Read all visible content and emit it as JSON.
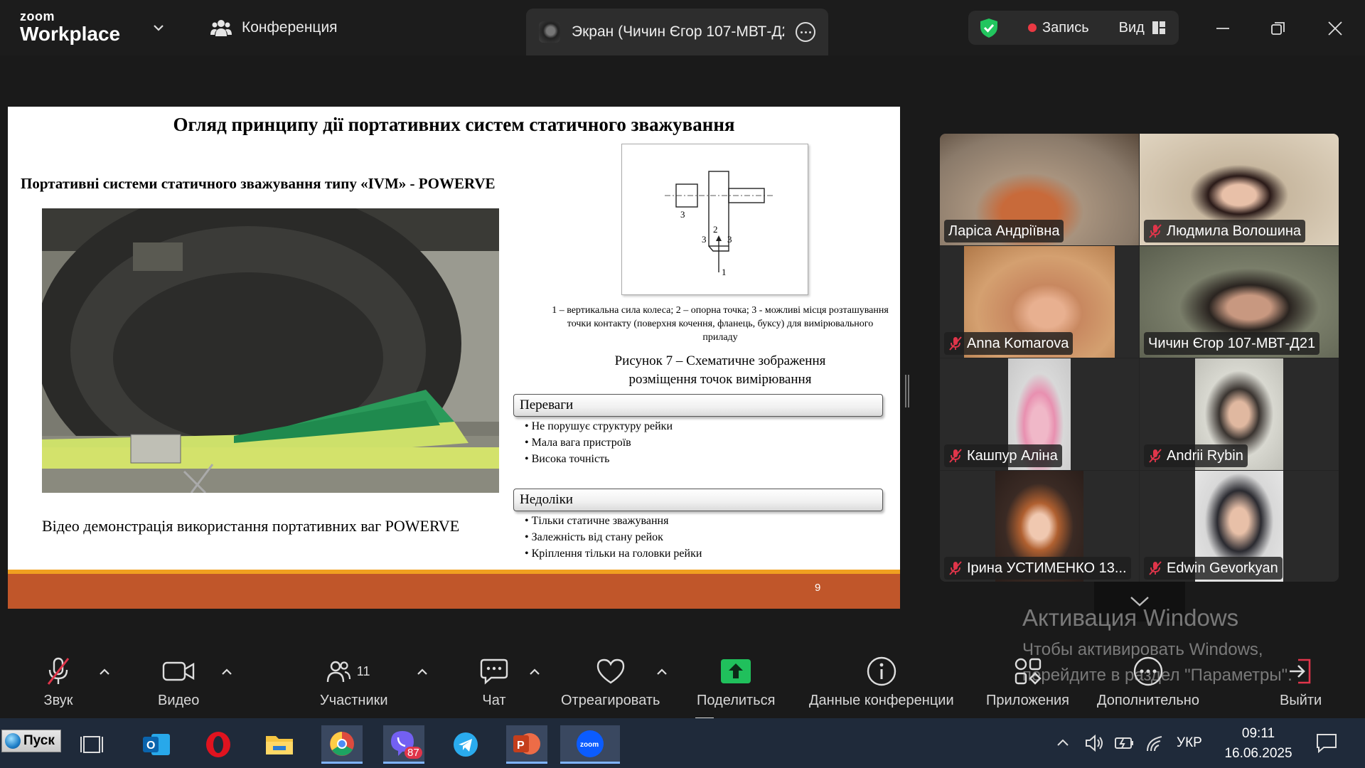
{
  "app": {
    "logo_small": "zoom",
    "logo_big": "Workplace",
    "conference_tab": "Конференция",
    "screen_tab": "Экран (Чичин Єгор 107-МВТ-Д2",
    "record_label": "Запись",
    "view_label": "Вид"
  },
  "slide": {
    "title": "Огляд принципу дії портативних систем статичного зважування",
    "subtitle": "Портативні системи статичного зважування типу «IVM» - POWERVE",
    "video_caption": "Відео демонстрація використання портативних ваг POWERVE",
    "diagram_caption": "1 – вертикальна сила колеса; 2 – опорна точка; 3 - можливі місця розташування точки контакту (поверхня кочення, фланець, буксу) для вимірювального приладу",
    "figure_caption_1": "Рисунок 7 – Схематичне зображення",
    "figure_caption_2": "розміщення точок вимірювання",
    "diagram_labels": [
      "1",
      "2",
      "3",
      "3",
      "3"
    ],
    "advantages_title": "Переваги",
    "advantages": [
      "Не порушує структуру рейки",
      "Мала вага пристроїв",
      "Висока точність"
    ],
    "disadvantages_title": "Недоліки",
    "disadvantages": [
      "Тільки статичне зважування",
      "Залежність від стану рейок",
      "Кріплення тільки на головки рейки"
    ],
    "page_number": "9"
  },
  "participants": [
    {
      "name": "Ларіса Андріївна",
      "muted": false,
      "active": false
    },
    {
      "name": "Людмила Волошина",
      "muted": true,
      "active": false
    },
    {
      "name": "Anna Komarova",
      "muted": true,
      "active": false
    },
    {
      "name": "Чичин Єгор 107-МВТ-Д21",
      "muted": false,
      "active": true
    },
    {
      "name": "Кашпур Аліна",
      "muted": true,
      "active": false
    },
    {
      "name": "Andrii Rybin",
      "muted": true,
      "active": false
    },
    {
      "name": "Ірина УСТИМЕНКО 13...",
      "muted": true,
      "active": false
    },
    {
      "name": "Edwin Gevorkyan",
      "muted": true,
      "active": false
    }
  ],
  "watermark": {
    "line1": "Активация Windows",
    "line2": "Чтобы активировать Windows,",
    "line3": "перейдите в раздел \"Параметры\"."
  },
  "toolbar": {
    "audio": "Звук",
    "video": "Видео",
    "participants": "Участники",
    "participants_count": "11",
    "chat": "Чат",
    "react": "Отреагировать",
    "share": "Поделиться",
    "meeting_info": "Данные конференции",
    "apps": "Приложения",
    "more": "Дополнительно",
    "leave": "Выйти"
  },
  "taskbar": {
    "start": "Пуск",
    "viber_badge": "87",
    "language": "УКР",
    "time": "09:11",
    "date": "16.06.2025"
  },
  "colors": {
    "accent_green": "#25d46a",
    "record_red": "#ea3943",
    "share_green": "#20c05c",
    "slide_footer": "#c0562a"
  }
}
